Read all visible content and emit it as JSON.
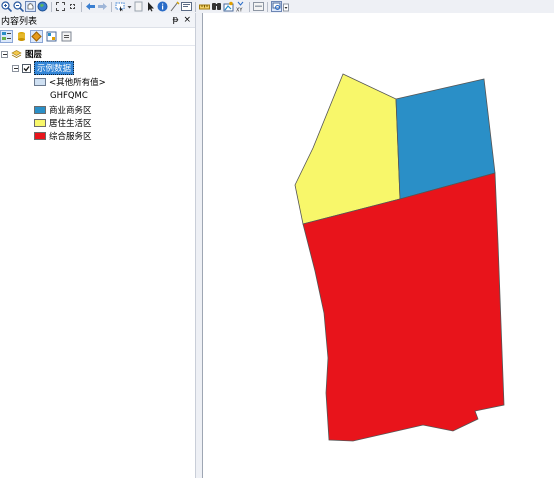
{
  "toc": {
    "title": "内容列表",
    "pin": "ᵽ",
    "close": "×"
  },
  "tree": {
    "root_label": "图层",
    "layer_label": "示例数据",
    "other_values_label": "<其他所有值>",
    "field_label": "GHFQMC",
    "legend": [
      {
        "label": "商业商务区",
        "color": "#2a8fc7"
      },
      {
        "label": "居住生活区",
        "color": "#f8f76a"
      },
      {
        "label": "综合服务区",
        "color": "#e8141b"
      }
    ]
  },
  "map": {
    "polygons": [
      {
        "name": "居住生活区",
        "color": "#f8f76a"
      },
      {
        "name": "商业商务区",
        "color": "#2a8fc7"
      },
      {
        "name": "综合服务区",
        "color": "#e8141b"
      }
    ]
  },
  "toolbar": {
    "icons": [
      "zoom-in-icon",
      "zoom-out-icon",
      "pan-icon",
      "full-extent-icon",
      "fixed-zoom-in-icon",
      "fixed-zoom-out-icon",
      "back-icon",
      "forward-icon",
      "select-features-icon",
      "clear-selection-icon",
      "select-elements-icon",
      "identify-icon",
      "html-popup-icon",
      "hyperlink-icon",
      "measure-icon",
      "find-icon",
      "find-route-icon",
      "goto-xy-icon",
      "time-slider-icon",
      "create-viewer-icon"
    ]
  }
}
